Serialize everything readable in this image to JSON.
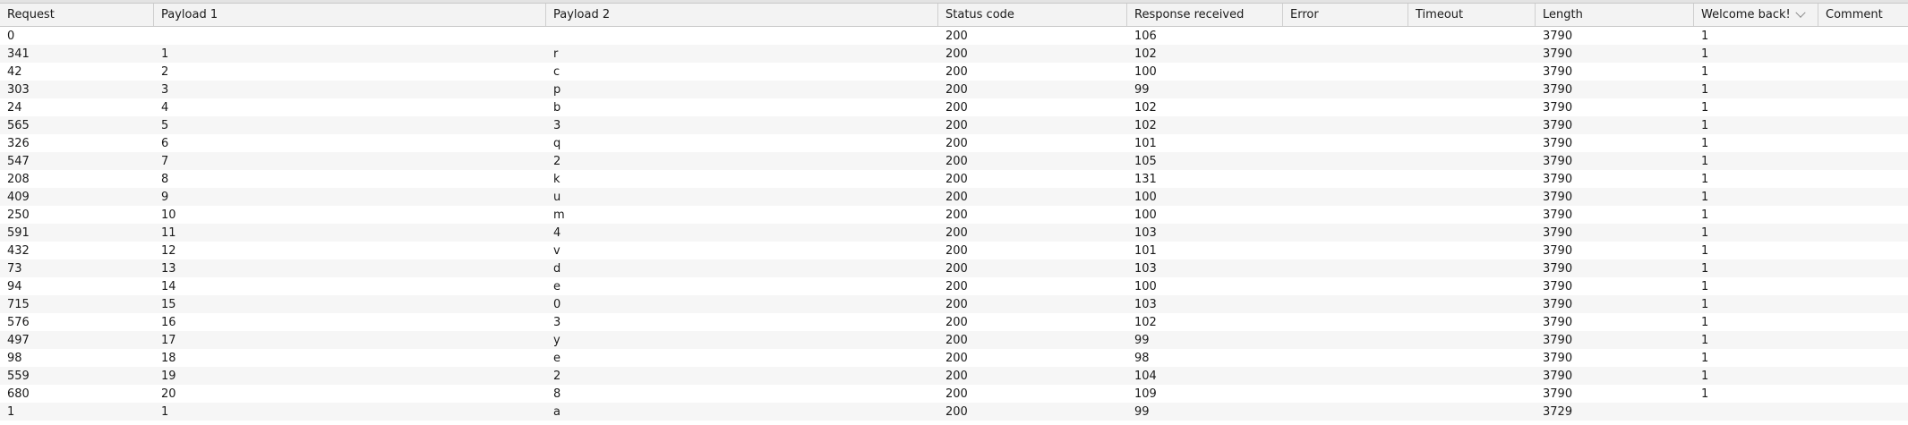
{
  "table": {
    "columns": [
      {
        "key": "request",
        "label": "Request"
      },
      {
        "key": "payload1",
        "label": "Payload 1"
      },
      {
        "key": "payload2",
        "label": "Payload 2"
      },
      {
        "key": "status",
        "label": "Status code"
      },
      {
        "key": "response",
        "label": "Response received"
      },
      {
        "key": "error",
        "label": "Error"
      },
      {
        "key": "timeout",
        "label": "Timeout"
      },
      {
        "key": "length",
        "label": "Length"
      },
      {
        "key": "welcome",
        "label": "Welcome back!",
        "sorted": "descending",
        "sort_icon": "chevron-down-icon"
      },
      {
        "key": "comment",
        "label": "Comment"
      }
    ],
    "rows": [
      [
        "0",
        "",
        "",
        "200",
        "106",
        "",
        "",
        "3790",
        "1",
        ""
      ],
      [
        "341",
        "1",
        "r",
        "200",
        "102",
        "",
        "",
        "3790",
        "1",
        ""
      ],
      [
        "42",
        "2",
        "c",
        "200",
        "100",
        "",
        "",
        "3790",
        "1",
        ""
      ],
      [
        "303",
        "3",
        "p",
        "200",
        "99",
        "",
        "",
        "3790",
        "1",
        ""
      ],
      [
        "24",
        "4",
        "b",
        "200",
        "102",
        "",
        "",
        "3790",
        "1",
        ""
      ],
      [
        "565",
        "5",
        "3",
        "200",
        "102",
        "",
        "",
        "3790",
        "1",
        ""
      ],
      [
        "326",
        "6",
        "q",
        "200",
        "101",
        "",
        "",
        "3790",
        "1",
        ""
      ],
      [
        "547",
        "7",
        "2",
        "200",
        "105",
        "",
        "",
        "3790",
        "1",
        ""
      ],
      [
        "208",
        "8",
        "k",
        "200",
        "131",
        "",
        "",
        "3790",
        "1",
        ""
      ],
      [
        "409",
        "9",
        "u",
        "200",
        "100",
        "",
        "",
        "3790",
        "1",
        ""
      ],
      [
        "250",
        "10",
        "m",
        "200",
        "100",
        "",
        "",
        "3790",
        "1",
        ""
      ],
      [
        "591",
        "11",
        "4",
        "200",
        "103",
        "",
        "",
        "3790",
        "1",
        ""
      ],
      [
        "432",
        "12",
        "v",
        "200",
        "101",
        "",
        "",
        "3790",
        "1",
        ""
      ],
      [
        "73",
        "13",
        "d",
        "200",
        "103",
        "",
        "",
        "3790",
        "1",
        ""
      ],
      [
        "94",
        "14",
        "e",
        "200",
        "100",
        "",
        "",
        "3790",
        "1",
        ""
      ],
      [
        "715",
        "15",
        "0",
        "200",
        "103",
        "",
        "",
        "3790",
        "1",
        ""
      ],
      [
        "576",
        "16",
        "3",
        "200",
        "102",
        "",
        "",
        "3790",
        "1",
        ""
      ],
      [
        "497",
        "17",
        "y",
        "200",
        "99",
        "",
        "",
        "3790",
        "1",
        ""
      ],
      [
        "98",
        "18",
        "e",
        "200",
        "98",
        "",
        "",
        "3790",
        "1",
        ""
      ],
      [
        "559",
        "19",
        "2",
        "200",
        "104",
        "",
        "",
        "3790",
        "1",
        ""
      ],
      [
        "680",
        "20",
        "8",
        "200",
        "109",
        "",
        "",
        "3790",
        "1",
        ""
      ],
      [
        "1",
        "1",
        "a",
        "200",
        "99",
        "",
        "",
        "3729",
        "",
        ""
      ],
      [
        "",
        "",
        "",
        "",
        "",
        "",
        "",
        "",
        "",
        ""
      ]
    ]
  }
}
